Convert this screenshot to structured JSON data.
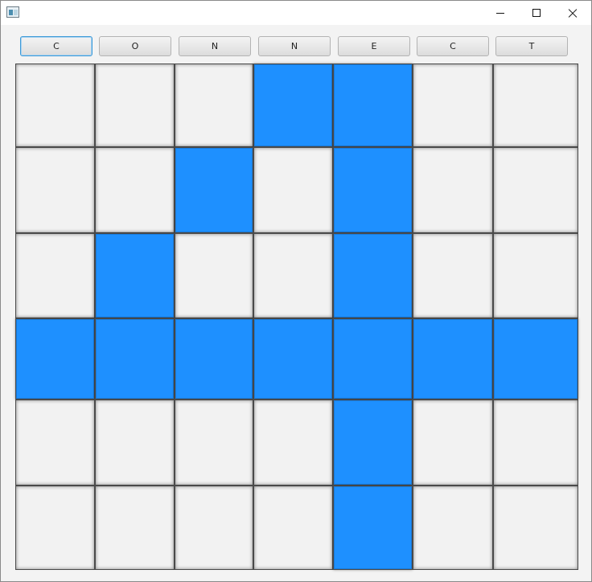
{
  "window": {
    "title": "",
    "app_icon": "java-window-icon",
    "controls": [
      "minimize-icon",
      "maximize-icon",
      "close-icon"
    ]
  },
  "column_buttons": [
    {
      "label": "C",
      "focused": true
    },
    {
      "label": "O",
      "focused": false
    },
    {
      "label": "N",
      "focused": false
    },
    {
      "label": "N",
      "focused": false
    },
    {
      "label": "E",
      "focused": false
    },
    {
      "label": "C",
      "focused": false
    },
    {
      "label": "T",
      "focused": false
    }
  ],
  "board": {
    "columns": 7,
    "rows": 6,
    "empty_color": "#f2f2f2",
    "filled_color": "#1e90ff",
    "grid": [
      [
        0,
        0,
        0,
        1,
        1,
        0,
        0
      ],
      [
        0,
        0,
        1,
        0,
        1,
        0,
        0
      ],
      [
        0,
        1,
        0,
        0,
        1,
        0,
        0
      ],
      [
        1,
        1,
        1,
        1,
        1,
        1,
        1
      ],
      [
        0,
        0,
        0,
        0,
        1,
        0,
        0
      ],
      [
        0,
        0,
        0,
        0,
        1,
        0,
        0
      ]
    ]
  }
}
